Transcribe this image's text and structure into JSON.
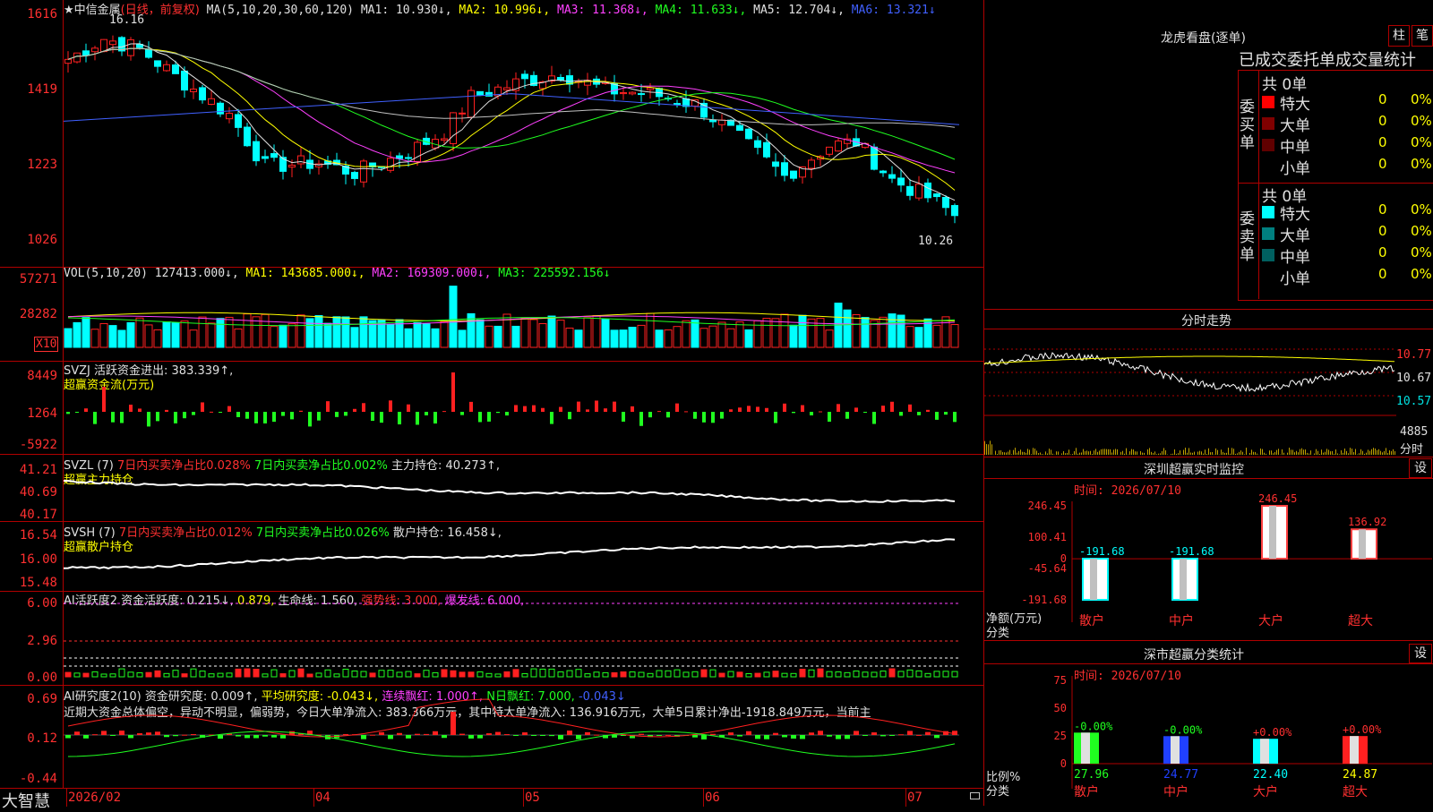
{
  "kline": {
    "title": "★中信金属",
    "mode": "(日线，前复权)",
    "ma_prefix": "MA(5,10,20,30,60,120)",
    "ma1": "MA1: 10.930↓,",
    "ma2": "MA2: 10.996↓,",
    "ma3": "MA3: 11.368↓,",
    "ma4": "MA4: 11.633↓,",
    "ma5": "MA5: 12.704↓,",
    "ma6": "MA6: 13.321↓",
    "high_label": "16.16",
    "low_label": "10.26",
    "yticks": [
      "1616",
      "1419",
      "1223",
      "1026"
    ]
  },
  "vol": {
    "label": "VOL(5,10,20)",
    "value": "127413.000↓,",
    "ma1": "MA1: 143685.000↓,",
    "ma2": "MA2: 169309.000↓,",
    "ma3": "MA3: 225592.156↓",
    "yticks": [
      "57271",
      "28282"
    ],
    "unit": "X10"
  },
  "svzj": {
    "line1": "SVZJ  活跃资金进出: 383.339↑,",
    "line2": "超赢资金流(万元)",
    "yticks": [
      "8449",
      "1264",
      "-5922"
    ]
  },
  "svzl": {
    "name": "SVZL (7)",
    "a": "7日内买卖净占比0.028%",
    "b": "7日内买卖净占比0.002%",
    "c": "主力持仓: 40.273↑,",
    "sub": "超赢主力持仓",
    "yticks": [
      "41.21",
      "40.69",
      "40.17"
    ]
  },
  "svsh": {
    "name": "SVSH (7)",
    "a": "7日内买卖净占比0.012%",
    "b": "7日内买卖净占比0.026%",
    "c": "散户持仓: 16.458↓,",
    "sub": "超赢散户持仓",
    "yticks": [
      "16.54",
      "16.00",
      "15.48"
    ]
  },
  "ai1": {
    "a": "AI活跃度2 资金活跃度: 0.215↓,",
    "b": "0.879,",
    "c": "生命线: 1.560,",
    "d": "强势线: 3.000,",
    "e": "爆发线: 6.000,",
    "yticks": [
      "6.00",
      "2.96",
      "0.00"
    ]
  },
  "ai2": {
    "a": "AI研究度2(10) 资金研究度: 0.009↑,",
    "b": "平均研究度: -0.043↓,",
    "c": "连续飘红: 1.000↑,",
    "d": "N日飘红: 7.000,",
    "e": "-0.043↓",
    "text": "近期大资金总体偏空，异动不明显，偏弱势，今日大单净流入: 383.366万元，其中特大单净流入: 136.916万元，大单5日累计净出-1918.849万元，当前主",
    "yticks": [
      "0.69",
      "0.12",
      "-0.44"
    ]
  },
  "xaxis": {
    "logo": "大智慧",
    "labels": [
      "2026/02",
      "04",
      "05",
      "06",
      "07"
    ]
  },
  "longhu": {
    "title": "龙虎看盘(逐单)",
    "btn1": "柱",
    "btn2": "笔",
    "header": "已成交委托单成交量统计",
    "buy_label": "委买单",
    "sell_label": "委卖单",
    "buy_total": "共 0单",
    "sell_total": "共 0单",
    "buy_rows": [
      {
        "name": "特大",
        "count": "0",
        "pct": "0%",
        "color": "#ff0000"
      },
      {
        "name": "大单",
        "count": "0",
        "pct": "0%",
        "color": "#800000"
      },
      {
        "name": "中单",
        "count": "0",
        "pct": "0%",
        "color": "#600000"
      },
      {
        "name": "小单",
        "count": "0",
        "pct": "0%",
        "color": "#000000"
      }
    ],
    "sell_rows": [
      {
        "name": "特大",
        "count": "0",
        "pct": "0%",
        "color": "#00ffff"
      },
      {
        "name": "大单",
        "count": "0",
        "pct": "0%",
        "color": "#008080"
      },
      {
        "name": "中单",
        "count": "0",
        "pct": "0%",
        "color": "#006060"
      },
      {
        "name": "小单",
        "count": "0",
        "pct": "0%",
        "color": "#000000"
      }
    ]
  },
  "intraday": {
    "title": "分时走势",
    "prices": [
      "10.77",
      "10.67",
      "10.57"
    ],
    "vol": "4885",
    "unit": "分时"
  },
  "sz_monitor": {
    "title": "深圳超赢实时监控",
    "btn": "设",
    "time": "时间: 2026/07/10",
    "yticks": [
      "246.45",
      "100.41",
      "0",
      "-45.64",
      "-191.68"
    ],
    "ylabel1": "净额(万元)",
    "ylabel2": "分类",
    "bars": [
      {
        "cat": "散户",
        "value": -191.68,
        "label": "-191.68"
      },
      {
        "cat": "中户",
        "value": -191.68,
        "label": "-191.68"
      },
      {
        "cat": "大户",
        "value": 246.45,
        "label": "246.45"
      },
      {
        "cat": "超大",
        "value": 136.92,
        "label": "136.92"
      }
    ]
  },
  "sz_stats": {
    "title": "深市超赢分类统计",
    "btn": "设",
    "time": "时间: 2026/07/10",
    "yticks": [
      "75",
      "50",
      "25",
      "0"
    ],
    "ylabel1": "比例%",
    "ylabel2": "分类",
    "bars": [
      {
        "cat": "散户",
        "value": 27.96,
        "chg": "-0.00%",
        "color": "#20ff20"
      },
      {
        "cat": "中户",
        "value": 24.77,
        "chg": "-0.00%",
        "color": "#2040ff"
      },
      {
        "cat": "大户",
        "value": 22.4,
        "chg": "+0.00%",
        "color": "#00ffff"
      },
      {
        "cat": "超大",
        "value": 24.87,
        "chg": "+0.00%",
        "color": "#ff2020"
      }
    ]
  }
}
